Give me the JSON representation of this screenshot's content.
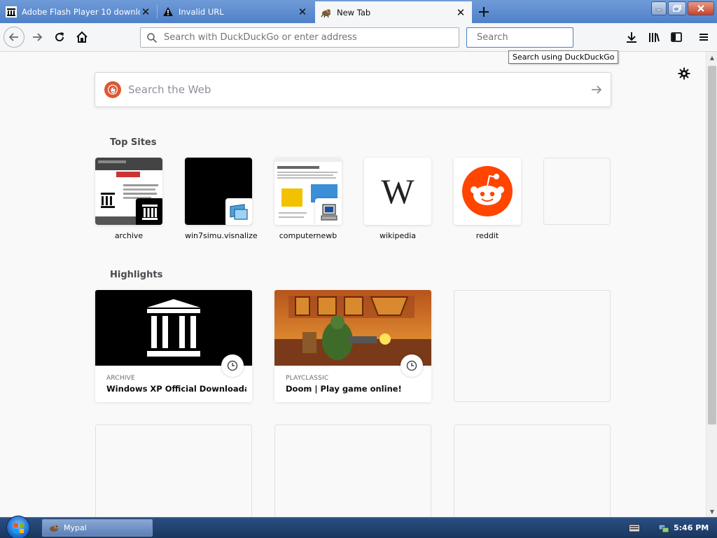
{
  "tabs": [
    {
      "title": "Adobe Flash Player 10 downloa",
      "icon": "archive-icon",
      "active": false
    },
    {
      "title": "Invalid URL",
      "icon": "warning-icon",
      "active": false
    },
    {
      "title": "New Tab",
      "icon": "mypal-icon",
      "active": true
    }
  ],
  "toolbar": {
    "url_placeholder": "Search with DuckDuckGo or enter address",
    "search_placeholder": "Search",
    "search_tooltip": "Search using DuckDuckGo"
  },
  "newtab": {
    "web_search_placeholder": "Search the Web",
    "top_sites_title": "Top Sites",
    "highlights_title": "Highlights",
    "top_sites": [
      {
        "label": "archive"
      },
      {
        "label": "win7simu.visnalize"
      },
      {
        "label": "computernewb"
      },
      {
        "label": "wikipedia",
        "tile_text": "W"
      },
      {
        "label": "reddit"
      }
    ],
    "highlights": [
      {
        "source": "ARCHIVE",
        "title": "Windows XP Official Downloada..."
      },
      {
        "source": "PLAYCLASSIC",
        "title": "Doom | Play game online!"
      }
    ]
  },
  "taskbar": {
    "app_label": "Mypal",
    "time": "5:46 PM"
  },
  "colors": {
    "titlebar": "#4f80c8",
    "active_tab": "#f5f6f7",
    "reddit": "#ff4500",
    "duckduckgo": "#de5833"
  }
}
